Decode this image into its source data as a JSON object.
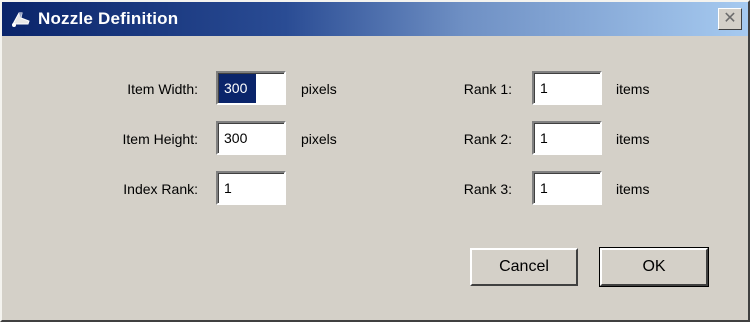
{
  "window": {
    "title": "Nozzle Definition",
    "close_glyph": "✕",
    "title_icon": "nozzle-icon"
  },
  "form": {
    "item_width": {
      "label": "Item Width:",
      "value": "300",
      "unit": "pixels"
    },
    "item_height": {
      "label": "Item Height:",
      "value": "300",
      "unit": "pixels"
    },
    "index_rank": {
      "label": "Index Rank:",
      "value": "1"
    },
    "rank1": {
      "label": "Rank 1:",
      "value": "1",
      "unit": "items"
    },
    "rank2": {
      "label": "Rank 2:",
      "value": "1",
      "unit": "items"
    },
    "rank3": {
      "label": "Rank 3:",
      "value": "1",
      "unit": "items"
    }
  },
  "buttons": {
    "cancel": "Cancel",
    "ok": "OK"
  },
  "colors": {
    "titlebar_start": "#0a246a",
    "titlebar_end": "#a6caf0",
    "dialog_bg": "#d4d0c8",
    "selection": "#0a246a"
  }
}
